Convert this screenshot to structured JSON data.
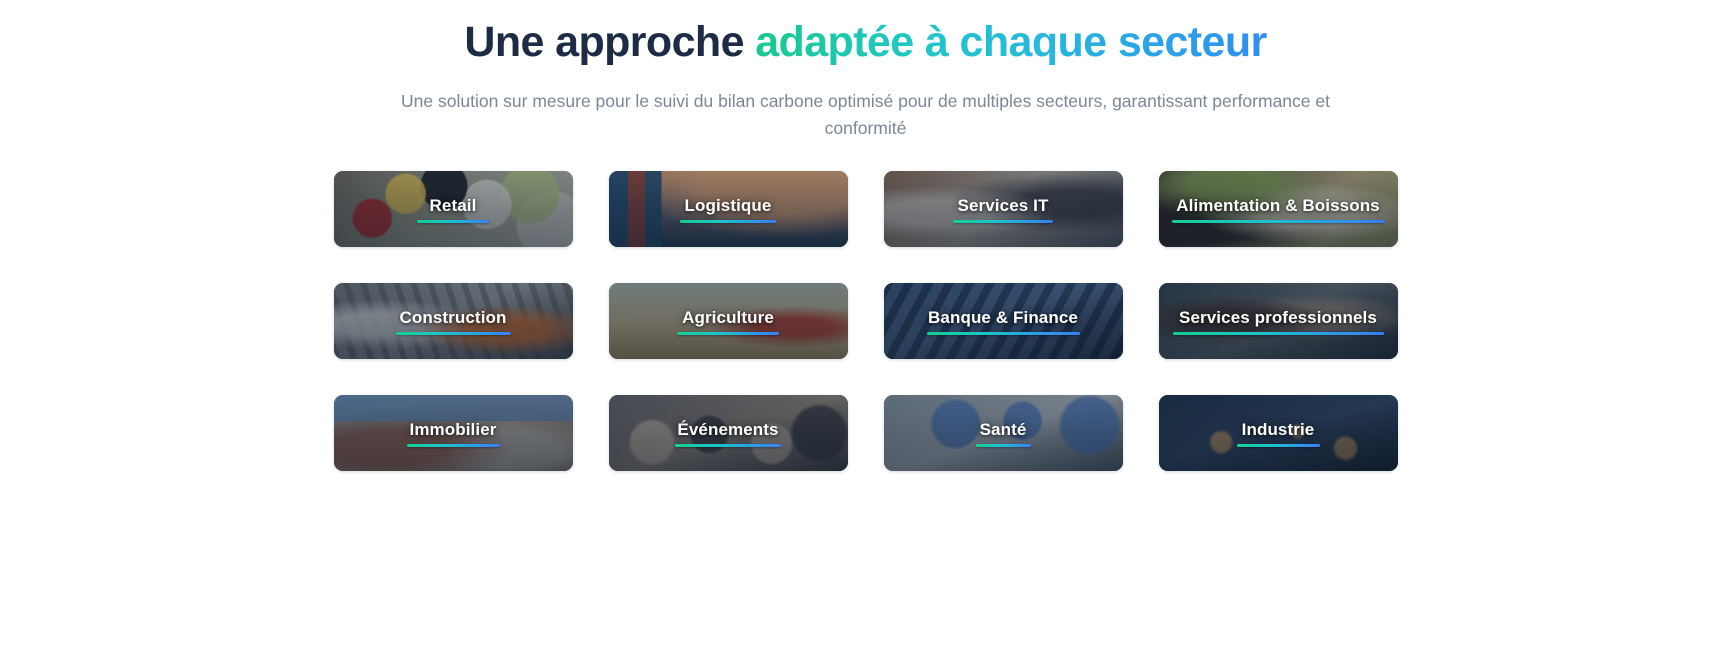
{
  "header": {
    "title_part_dark": "Une approche ",
    "title_part_gradient": "adaptée à chaque secteur",
    "subtitle": "Une solution sur mesure pour le suivi du bilan carbone optimisé pour de multiples secteurs, garantissant performance et conformité"
  },
  "colors": {
    "title_dark": "#1d2b45",
    "gradient_start": "#17c98f",
    "gradient_mid": "#28b6df",
    "gradient_end": "#2f8ef0",
    "subtitle": "#7a8794",
    "card_label": "#ffffff",
    "page_background": "#ffffff"
  },
  "sectors": {
    "cards": [
      {
        "label": "Retail",
        "photo": "photo-retail",
        "underline_width": 72
      },
      {
        "label": "Logistique",
        "photo": "photo-logistique",
        "underline_width": 96
      },
      {
        "label": "Services IT",
        "photo": "photo-services-it",
        "underline_width": 100
      },
      {
        "label": "Alimentation & Boissons",
        "photo": "photo-alimentation",
        "underline_width": 213
      },
      {
        "label": "Construction",
        "photo": "photo-construction",
        "underline_width": 115
      },
      {
        "label": "Agriculture",
        "photo": "photo-agriculture",
        "underline_width": 102
      },
      {
        "label": "Banque & Finance",
        "photo": "photo-banque",
        "underline_width": 153
      },
      {
        "label": "Services professionnels",
        "photo": "photo-services-pro",
        "underline_width": 211
      },
      {
        "label": "Immobilier",
        "photo": "photo-immobilier",
        "underline_width": 93
      },
      {
        "label": "Événements",
        "photo": "photo-evenements",
        "underline_width": 106
      },
      {
        "label": "Santé",
        "photo": "photo-sante",
        "underline_width": 55
      },
      {
        "label": "Industrie",
        "photo": "photo-industrie",
        "underline_width": 83
      }
    ]
  }
}
